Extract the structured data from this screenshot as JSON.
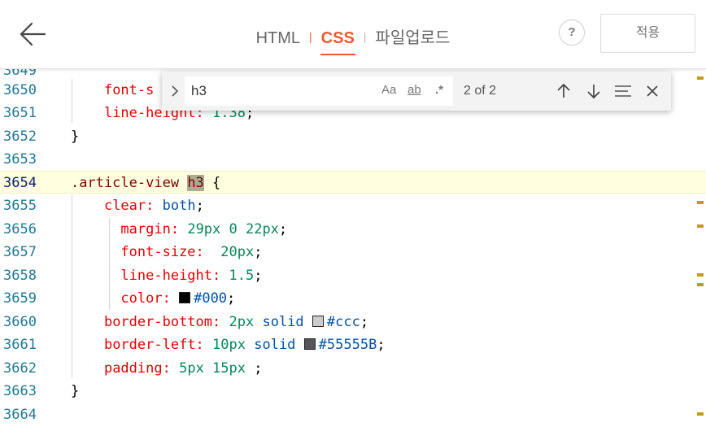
{
  "header": {
    "back_icon": "arrow-left-icon",
    "tabs": [
      {
        "label": "HTML",
        "active": false
      },
      {
        "label": "CSS",
        "active": true
      },
      {
        "label": "파일업로드",
        "active": false
      }
    ],
    "help_label": "?",
    "apply_label": "적용",
    "accent_color": "#ef5a2a"
  },
  "find": {
    "query": "h3",
    "options": {
      "match_case": "Aa",
      "whole_word": "ab",
      "regex": ".*"
    },
    "count": "2 of 2",
    "icons": [
      "chevron-right-icon",
      "arrow-up-icon",
      "arrow-down-icon",
      "find-in-selection-icon",
      "close-icon"
    ]
  },
  "editor": {
    "partial_top_line": "3649",
    "line_numbers": [
      "3650",
      "3651",
      "3652",
      "3653",
      "3654",
      "3655",
      "3656",
      "3657",
      "3658",
      "3659",
      "3660",
      "3661",
      "3662",
      "3663",
      "3664"
    ],
    "current_line": "3654",
    "lines": {
      "l3650": {
        "prop": "font-s"
      },
      "l3651": {
        "prop": "line-height:",
        "val": "1.38",
        "end": ";"
      },
      "l3652": {
        "text": "}"
      },
      "l3654": {
        "selector": ".article-view",
        "match": "h3",
        "brace": "{"
      },
      "l3655": {
        "prop": "clear:",
        "val": "both",
        "end": ";"
      },
      "l3656": {
        "prop": "margin:",
        "val": "29px 0 22px",
        "end": ";"
      },
      "l3657": {
        "prop": "font-size:",
        "val": "20px",
        "end": ";"
      },
      "l3658": {
        "prop": "line-height:",
        "val": "1.5",
        "end": ";"
      },
      "l3659": {
        "prop": "color:",
        "val": "#000",
        "end": ";",
        "swatch": "#000000"
      },
      "l3660": {
        "prop": "border-bottom:",
        "val1": "2px",
        "val2": "solid",
        "val": "#ccc",
        "end": ";",
        "swatch": "#cccccc"
      },
      "l3661": {
        "prop": "border-left:",
        "val1": "10px",
        "val2": "solid",
        "val": "#55555B",
        "end": ";",
        "swatch": "#55555b"
      },
      "l3662": {
        "prop": "padding:",
        "val": "5px 15px",
        "end": ";"
      },
      "l3663": {
        "text": "}"
      }
    }
  },
  "ruler_color": "#c69a12"
}
